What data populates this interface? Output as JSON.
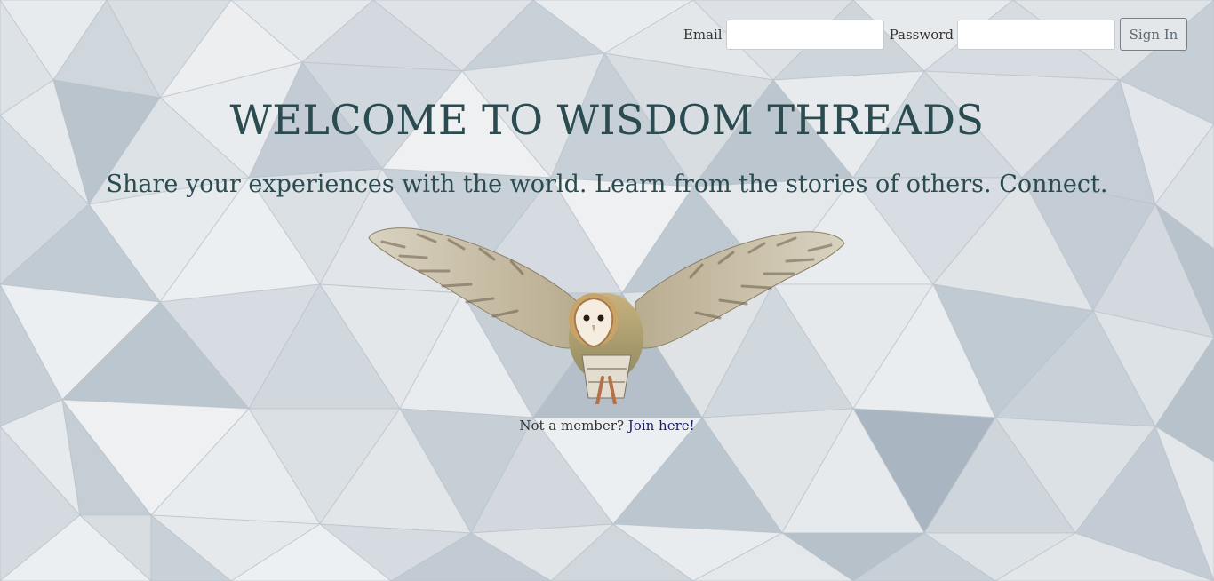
{
  "login": {
    "email_label": "Email",
    "email_value": "",
    "password_label": "Password",
    "password_value": "",
    "signin_label": "Sign In"
  },
  "hero": {
    "title": "WELCOME TO WISDOM THREADS",
    "tagline": "Share your experiences with the world. Learn from the stories of others. Connect."
  },
  "join": {
    "prompt": "Not a member?",
    "link_label": "Join here!"
  },
  "image": {
    "icon": "barn-owl-flying"
  },
  "colors": {
    "heading": "#2a4b4f",
    "link": "#1a1a66",
    "background": "#dfe3e7"
  }
}
